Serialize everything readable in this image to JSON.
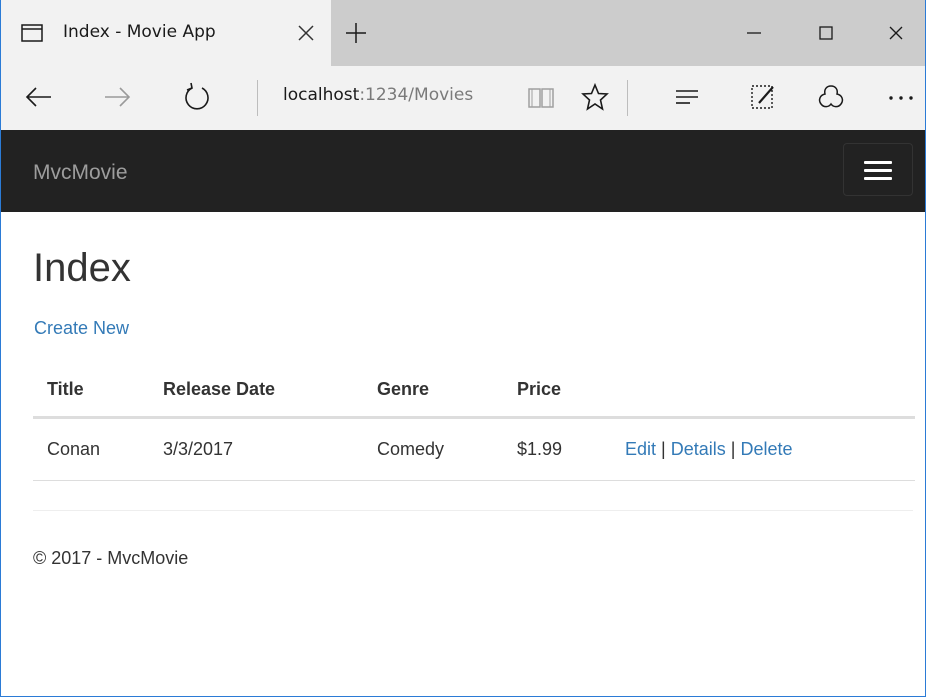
{
  "browser": {
    "tab_title": "Index - Movie App",
    "url_host": "localhost",
    "url_path": ":1234/Movies",
    "icons": [
      "tab-page-icon",
      "close-icon",
      "plus-icon",
      "minimize-icon",
      "maximize-icon",
      "close-icon",
      "back-arrow-icon",
      "forward-arrow-icon",
      "refresh-icon",
      "reading-view-icon",
      "star-icon",
      "hub-icon",
      "web-note-icon",
      "share-icon",
      "more-icon"
    ]
  },
  "navbar": {
    "brand": "MvcMovie",
    "background": "#222222",
    "toggle_icon": "hamburger-menu-icon"
  },
  "page": {
    "heading": "Index",
    "create_new": "Create New"
  },
  "table": {
    "columns": [
      "Title",
      "Release Date",
      "Genre",
      "Price"
    ],
    "rows": [
      {
        "title": "Conan",
        "release_date": "3/3/2017",
        "genre": "Comedy",
        "price": "$1.99",
        "edit": "Edit",
        "details": "Details",
        "delete": "Delete"
      }
    ],
    "separator": "|"
  },
  "footer": {
    "text": "© 2017 - MvcMovie"
  },
  "colors": {
    "link": "#337ab7",
    "text": "#333333",
    "brand_text": "#9d9d9d"
  }
}
